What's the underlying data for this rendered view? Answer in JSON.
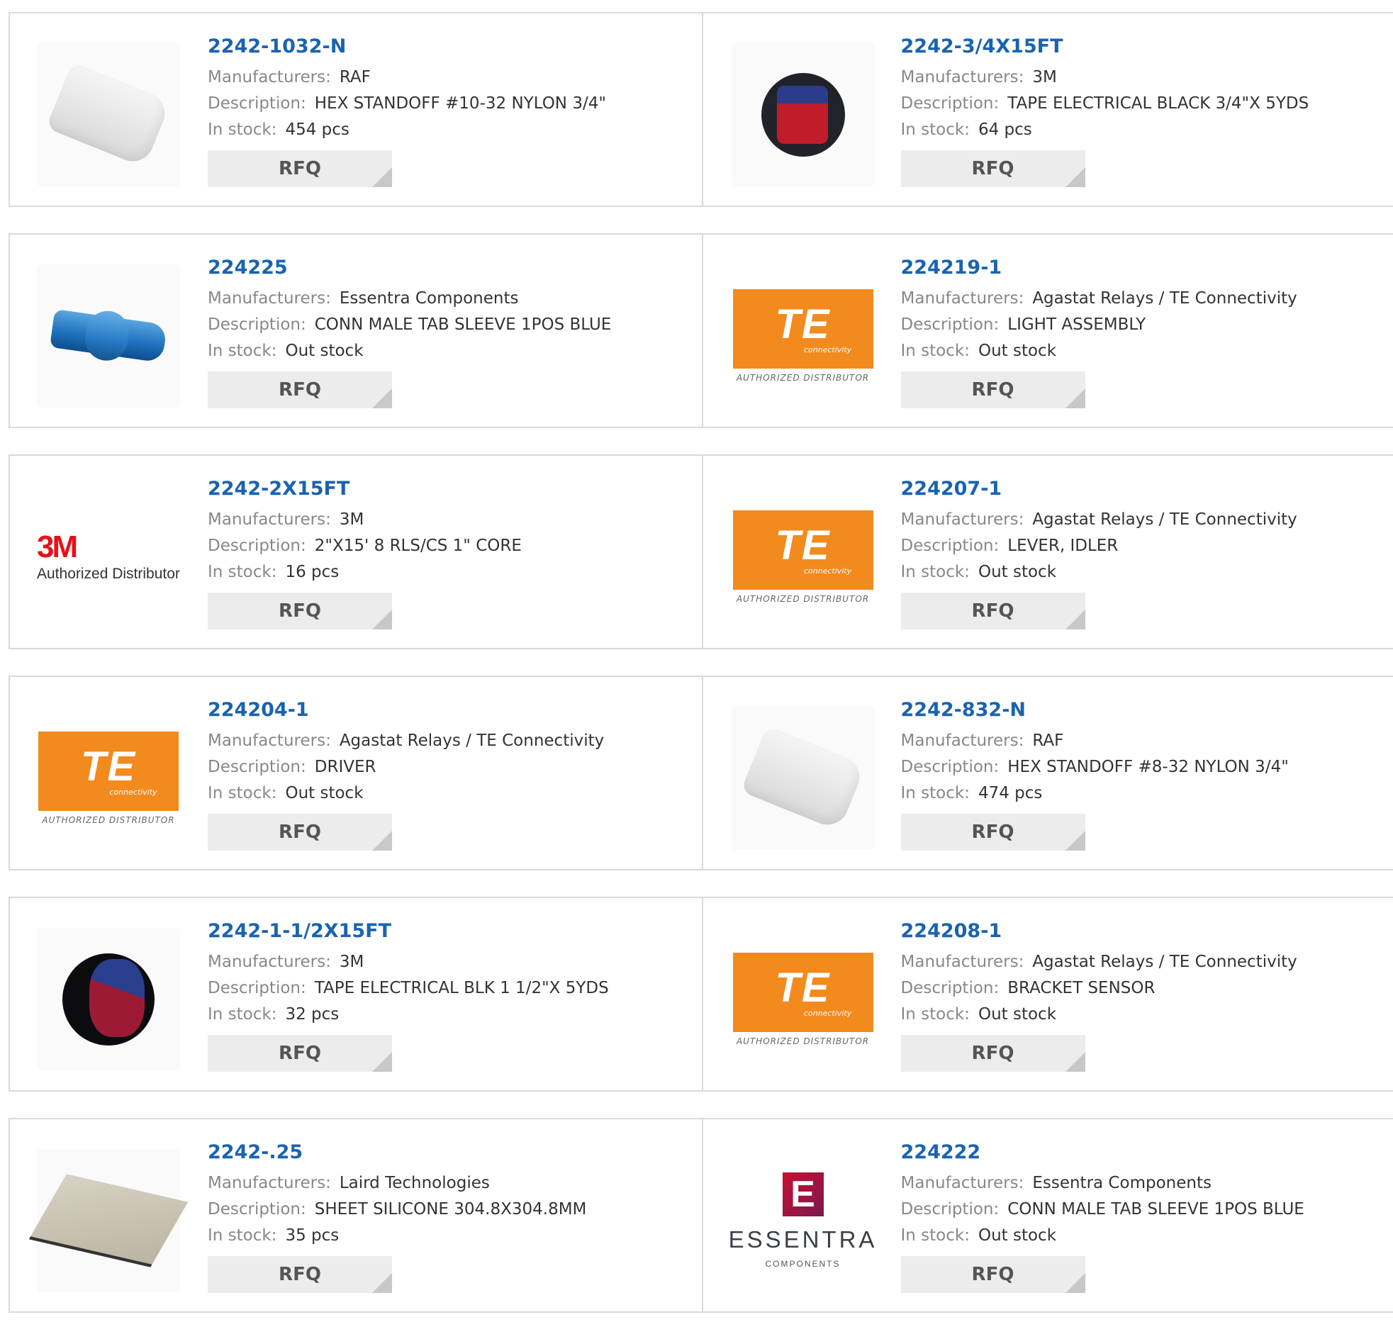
{
  "labels": {
    "manufacturers": "Manufacturers:",
    "description": "Description:",
    "in_stock": "In stock:",
    "rfq": "RFQ"
  },
  "logo_text": {
    "te": "TE",
    "te_sub": "connectivity",
    "te_authorized": "AUTHORIZED DISTRIBUTOR",
    "mmm": "3M",
    "mmm_authorized": "Authorized Distributor",
    "essentra_mark": "E",
    "essentra_name": "ESSENTRA",
    "essentra_sub": "COMPONENTS"
  },
  "products": [
    {
      "part": "2242-1032-N",
      "manufacturer": "RAF",
      "description": "HEX STANDOFF #10-32 NYLON 3/4\"",
      "stock": "454 pcs",
      "image": "standoff"
    },
    {
      "part": "2242-3/4X15FT",
      "manufacturer": "3M",
      "description": "TAPE ELECTRICAL BLACK 3/4\"X 5YDS",
      "stock": "64 pcs",
      "image": "tape"
    },
    {
      "part": "224225",
      "manufacturer": "Essentra Components",
      "description": "CONN MALE TAB SLEEVE 1POS BLUE",
      "stock": "Out stock",
      "image": "sleeve"
    },
    {
      "part": "224219-1",
      "manufacturer": "Agastat Relays / TE Connectivity",
      "description": "LIGHT ASSEMBLY",
      "stock": "Out stock",
      "image": "te-logo"
    },
    {
      "part": "2242-2X15FT",
      "manufacturer": "3M",
      "description": "2\"X15' 8 RLS/CS 1\" CORE",
      "stock": "16 pcs",
      "image": "3m-logo"
    },
    {
      "part": "224207-1",
      "manufacturer": "Agastat Relays / TE Connectivity",
      "description": "LEVER, IDLER",
      "stock": "Out stock",
      "image": "te-logo"
    },
    {
      "part": "224204-1",
      "manufacturer": "Agastat Relays / TE Connectivity",
      "description": "DRIVER",
      "stock": "Out stock",
      "image": "te-logo"
    },
    {
      "part": "2242-832-N",
      "manufacturer": "RAF",
      "description": "HEX STANDOFF #8-32 NYLON 3/4\"",
      "stock": "474 pcs",
      "image": "standoff"
    },
    {
      "part": "2242-1-1/2X15FT",
      "manufacturer": "3M",
      "description": "TAPE ELECTRICAL BLK 1 1/2\"X 5YDS",
      "stock": "32 pcs",
      "image": "tape-black"
    },
    {
      "part": "224208-1",
      "manufacturer": "Agastat Relays / TE Connectivity",
      "description": "BRACKET SENSOR",
      "stock": "Out stock",
      "image": "te-logo"
    },
    {
      "part": "2242-.25",
      "manufacturer": "Laird Technologies",
      "description": "SHEET SILICONE 304.8X304.8MM",
      "stock": "35 pcs",
      "image": "sheet"
    },
    {
      "part": "224222",
      "manufacturer": "Essentra Components",
      "description": "CONN MALE TAB SLEEVE 1POS BLUE",
      "stock": "Out stock",
      "image": "essentra-logo"
    }
  ],
  "colors": {
    "part_link": "#1a63b0",
    "te_orange": "#f28a1e",
    "mmm_red": "#e3131b",
    "rfq_bg": "#ececec"
  }
}
